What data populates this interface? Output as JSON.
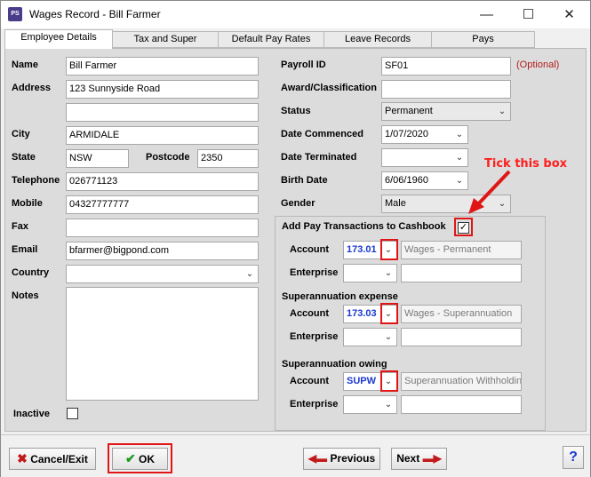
{
  "window": {
    "title": "Wages Record - Bill Farmer",
    "app_icon": "PS"
  },
  "tabs": [
    "Employee Details",
    "Tax and Super",
    "Default Pay Rates",
    "Leave Records",
    "Pays"
  ],
  "left": {
    "name_label": "Name",
    "name": "Bill Farmer",
    "address_label": "Address",
    "address1": "123 Sunnyside Road",
    "address2": "",
    "city_label": "City",
    "city": "ARMIDALE",
    "state_label": "State",
    "state": "NSW",
    "postcode_label": "Postcode",
    "postcode": "2350",
    "telephone_label": "Telephone",
    "telephone": "026771123",
    "mobile_label": "Mobile",
    "mobile": "04327777777",
    "fax_label": "Fax",
    "fax": "",
    "email_label": "Email",
    "email": "bfarmer@bigpond.com",
    "country_label": "Country",
    "country": "",
    "notes_label": "Notes",
    "notes": "",
    "inactive_label": "Inactive"
  },
  "right": {
    "payroll_id_label": "Payroll ID",
    "payroll_id": "SF01",
    "optional": "(Optional)",
    "award_label": "Award/Classification",
    "award": "",
    "status_label": "Status",
    "status": "Permanent",
    "date_commenced_label": "Date Commenced",
    "date_commenced": "1/07/2020",
    "date_terminated_label": "Date Terminated",
    "date_terminated": "",
    "birth_date_label": "Birth Date",
    "birth_date": "6/06/1960",
    "gender_label": "Gender",
    "gender": "Male"
  },
  "cashbook": {
    "title": "Add Pay Transactions to Cashbook",
    "checked": "✓",
    "account_label": "Account",
    "enterprise_label": "Enterprise",
    "account_code": "173.01",
    "account_name": "Wages - Permanent",
    "super_expense_title": "Superannuation expense",
    "super_expense_code": "173.03",
    "super_expense_name": "Wages - Superannuation",
    "super_owing_title": "Superannuation owing",
    "super_owing_code": "SUPW",
    "super_owing_name": "Superannuation Withholding"
  },
  "annotation": "Tick this box",
  "footer": {
    "cancel": "Cancel/Exit",
    "ok": "OK",
    "previous": "Previous",
    "next": "Next",
    "help": "?"
  },
  "colors": {
    "annotation_red": "#e01616",
    "account_blue": "#1a3ad1"
  }
}
